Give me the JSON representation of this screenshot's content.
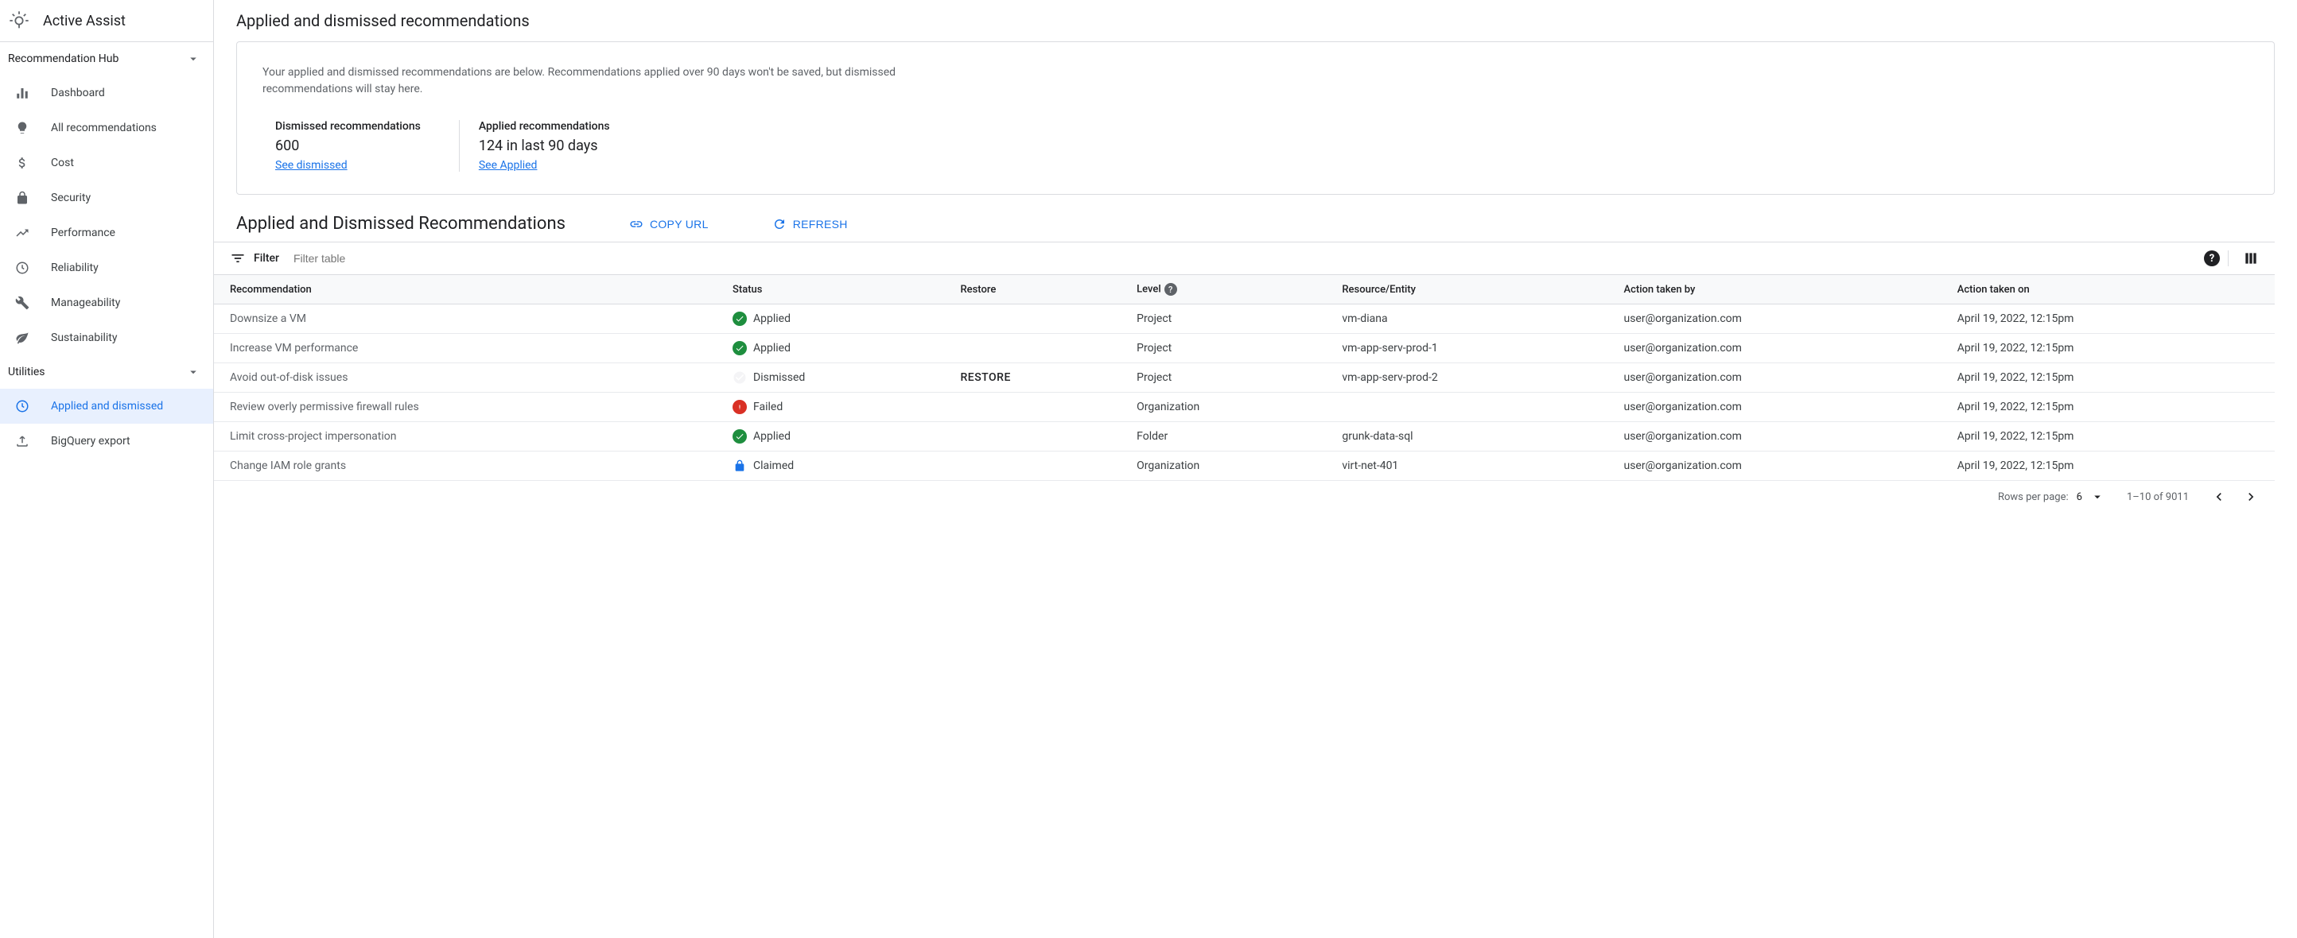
{
  "app_title": "Active Assist",
  "page_title": "Applied and dismissed recommendations",
  "sidebar": {
    "sections": [
      {
        "label": "Recommendation Hub",
        "items": [
          {
            "label": "Dashboard",
            "icon": "dashboard"
          },
          {
            "label": "All recommendations",
            "icon": "lightbulb"
          },
          {
            "label": "Cost",
            "icon": "dollar"
          },
          {
            "label": "Security",
            "icon": "lock"
          },
          {
            "label": "Performance",
            "icon": "trending"
          },
          {
            "label": "Reliability",
            "icon": "clock"
          },
          {
            "label": "Manageability",
            "icon": "wrench"
          },
          {
            "label": "Sustainability",
            "icon": "leaf"
          }
        ]
      },
      {
        "label": "Utilities",
        "items": [
          {
            "label": "Applied and dismissed",
            "icon": "clock",
            "active": true
          },
          {
            "label": "BigQuery export",
            "icon": "upload"
          }
        ]
      }
    ]
  },
  "card": {
    "intro": "Your applied and dismissed recommendations are below. Recommendations applied over 90 days won't be saved, but dismissed recommendations will stay here.",
    "dismissed_label": "Dismissed recommendations",
    "dismissed_value": "600",
    "dismissed_link": "See dismissed",
    "applied_label": "Applied recommendations",
    "applied_value": "124 in last 90 days",
    "applied_link": "See Applied"
  },
  "section_title": "Applied and Dismissed Recommendations",
  "actions": {
    "copy_url": "COPY URL",
    "refresh": "REFRESH"
  },
  "filter": {
    "label": "Filter",
    "placeholder": "Filter table"
  },
  "table": {
    "headers": {
      "recommendation": "Recommendation",
      "status": "Status",
      "restore": "Restore",
      "level": "Level",
      "resource": "Resource/Entity",
      "action_by": "Action taken by",
      "action_on": "Action taken on"
    },
    "restore_label": "RESTORE",
    "rows": [
      {
        "recommendation": "Downsize a VM",
        "status": "Applied",
        "status_type": "applied",
        "restore": "",
        "level": "Project",
        "resource": "vm-diana",
        "action_by": "user@organization.com",
        "action_on": "April 19, 2022, 12:15pm"
      },
      {
        "recommendation": "Increase VM performance",
        "status": "Applied",
        "status_type": "applied",
        "restore": "",
        "level": "Project",
        "resource": "vm-app-serv-prod-1",
        "action_by": "user@organization.com",
        "action_on": "April 19, 2022, 12:15pm"
      },
      {
        "recommendation": "Avoid out-of-disk issues",
        "status": "Dismissed",
        "status_type": "dismissed",
        "restore": "RESTORE",
        "level": "Project",
        "resource": "vm-app-serv-prod-2",
        "action_by": "user@organization.com",
        "action_on": "April 19, 2022, 12:15pm"
      },
      {
        "recommendation": "Review overly permissive firewall rules",
        "status": "Failed",
        "status_type": "failed",
        "restore": "",
        "level": "Organization",
        "resource": "",
        "action_by": "user@organization.com",
        "action_on": "April 19, 2022, 12:15pm"
      },
      {
        "recommendation": "Limit cross-project impersonation",
        "status": "Applied",
        "status_type": "applied",
        "restore": "",
        "level": "Folder",
        "resource": "grunk-data-sql",
        "action_by": "user@organization.com",
        "action_on": "April 19, 2022, 12:15pm"
      },
      {
        "recommendation": "Change IAM role grants",
        "status": "Claimed",
        "status_type": "claimed",
        "restore": "",
        "level": "Organization",
        "resource": "virt-net-401",
        "action_by": "user@organization.com",
        "action_on": "April 19, 2022, 12:15pm"
      }
    ]
  },
  "paginator": {
    "rows_per_page_label": "Rows per page:",
    "rows_per_page_value": "6",
    "range": "1–10 of 9011"
  }
}
